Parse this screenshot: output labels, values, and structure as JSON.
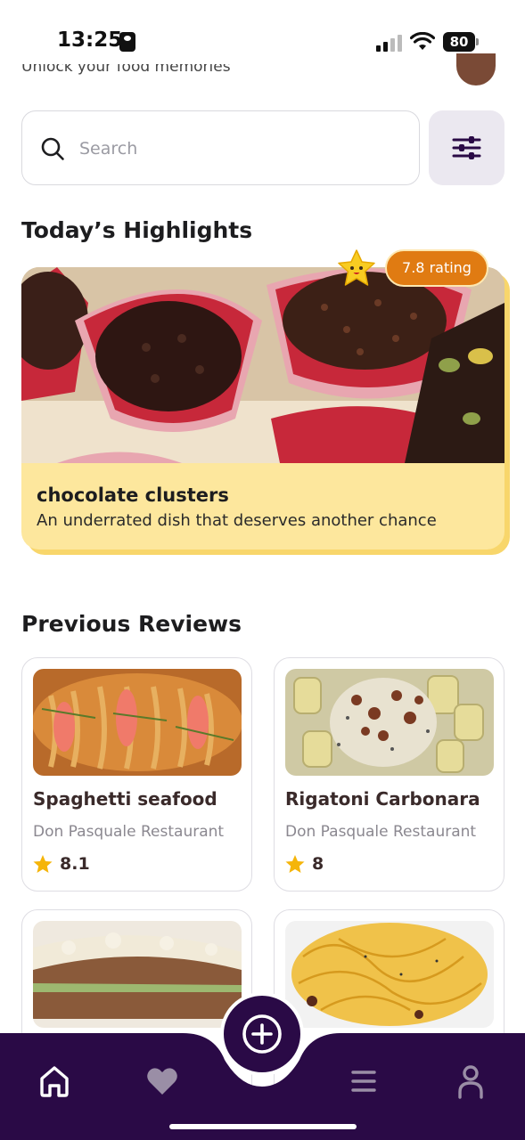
{
  "status_bar": {
    "time": "13:25",
    "battery": "80"
  },
  "header": {
    "subtitle": "Unlock your food memories"
  },
  "search": {
    "placeholder": "Search",
    "value": ""
  },
  "highlights": {
    "section_title": "Today’s Highlights",
    "rating_label": "7.8 rating",
    "dish_name": "chocolate clusters",
    "description": "An underrated dish that deserves another chance"
  },
  "reviews": {
    "section_title": "Previous Reviews",
    "items": [
      {
        "title": "Spaghetti seafood",
        "place": "Don Pasquale Restaurant",
        "score": "8.1"
      },
      {
        "title": "Rigatoni Carbonara",
        "place": "Don Pasquale Restaurant",
        "score": "8"
      },
      {
        "title": "",
        "place": "",
        "score": ""
      },
      {
        "title": "",
        "place": "",
        "score": ""
      }
    ]
  },
  "nav": {
    "items": [
      "home-icon",
      "heart-icon",
      "add-icon",
      "menu-icon",
      "profile-icon"
    ]
  },
  "colors": {
    "accent_dark": "#2a0a46",
    "highlight_bg": "#fde79d",
    "rating_orange": "#e07b12",
    "star_yellow": "#f5b50a"
  }
}
